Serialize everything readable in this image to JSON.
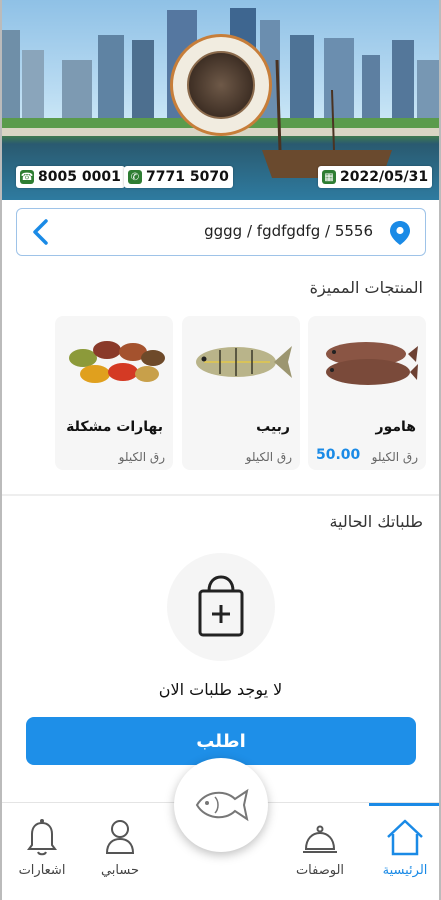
{
  "header": {
    "phone": "8005 0001",
    "whatsapp": "7771 5070",
    "date": "2022/05/31"
  },
  "address": {
    "text": "gggg / fgdfgdfg / 5556"
  },
  "featured": {
    "title": "المنتجات المميزة",
    "products": [
      {
        "name": "هامور",
        "unit": "رق الكيلو",
        "price": "50.00"
      },
      {
        "name": "ربيب",
        "unit": "رق الكيلو",
        "price": ""
      },
      {
        "name": "بهارات مشكلة",
        "unit": "رق الكيلو",
        "price": ""
      }
    ]
  },
  "orders": {
    "title": "طلباتك الحالية",
    "empty_text": "لا يوجد طلبات الان",
    "order_button": "اطلب"
  },
  "nav": {
    "home": "الرئيسية",
    "recipes": "الوصفات",
    "account": "حسابي",
    "notifications": "اشعارات"
  },
  "colors": {
    "accent": "#1e8fe8",
    "whatsapp": "#2e7d32"
  },
  "icons": [
    "phone-icon",
    "whatsapp-icon",
    "calendar-icon",
    "back-chevron-icon",
    "location-pin-icon",
    "shopping-bag-plus-icon",
    "fish-icon",
    "bell-icon",
    "user-icon",
    "cloche-icon",
    "home-icon"
  ]
}
